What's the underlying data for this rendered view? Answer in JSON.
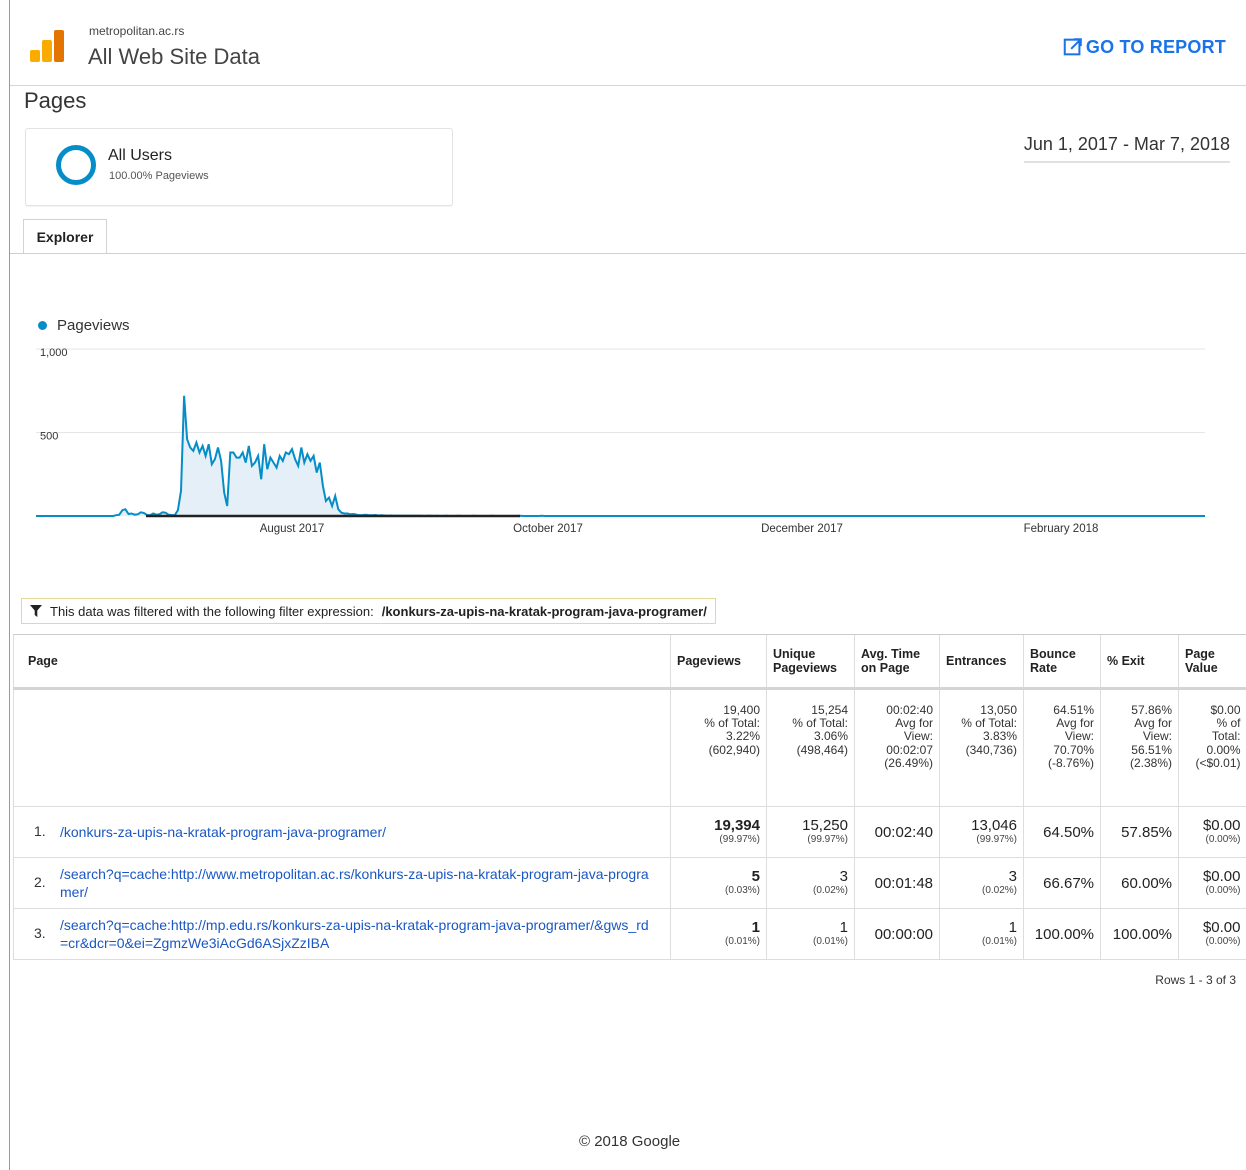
{
  "header": {
    "account": "metropolitan.ac.rs",
    "property": "All Web Site Data",
    "go_to_report": "GO TO REPORT"
  },
  "page_title": "Pages",
  "segment": {
    "name": "All Users",
    "subtitle": "100.00% Pageviews"
  },
  "date_range": "Jun 1, 2017 - Mar 7, 2018",
  "tabs": [
    {
      "label": "Explorer",
      "active": true
    }
  ],
  "chart_data": {
    "type": "area",
    "series": [
      {
        "name": "Pageviews",
        "color": "#058dc7"
      }
    ],
    "y_ticks": [
      "1,000",
      "500"
    ],
    "ylim": [
      0,
      1000
    ],
    "x_labels": [
      "August 2017",
      "October 2017",
      "December 2017",
      "February 2018"
    ],
    "values": [
      0,
      0,
      0,
      0,
      0,
      0,
      0,
      0,
      0,
      0,
      0,
      0,
      0,
      0,
      0,
      0,
      0,
      0,
      0,
      0,
      0,
      0,
      0,
      0,
      0,
      0,
      5,
      8,
      35,
      40,
      12,
      15,
      8,
      10,
      22,
      18,
      6,
      4,
      15,
      8,
      10,
      22,
      20,
      8,
      6,
      5,
      35,
      150,
      720,
      460,
      410,
      390,
      440,
      380,
      420,
      360,
      430,
      310,
      340,
      410,
      330,
      140,
      60,
      380,
      380,
      350,
      350,
      380,
      320,
      420,
      300,
      320,
      360,
      220,
      430,
      280,
      350,
      320,
      290,
      360,
      330,
      380,
      370,
      400,
      340,
      300,
      410,
      320,
      370,
      330,
      360,
      260,
      320,
      180,
      90,
      110,
      60,
      120,
      40,
      20,
      15,
      15,
      10,
      12,
      8,
      5,
      6,
      8,
      5,
      4,
      6,
      3,
      4,
      3,
      2,
      3,
      2,
      2,
      1,
      2,
      1,
      1,
      2,
      1,
      1,
      1,
      0,
      1,
      1,
      0,
      1,
      0,
      0,
      1,
      0,
      0,
      0,
      1,
      0,
      0,
      0,
      0,
      1,
      0,
      0,
      0,
      0,
      0,
      1,
      0,
      0,
      0,
      0,
      0,
      0,
      0,
      0,
      1,
      0,
      0,
      0,
      0,
      0,
      0,
      1,
      0,
      0,
      0,
      0,
      0,
      0,
      0,
      0,
      0,
      0,
      0,
      0,
      0,
      0,
      0,
      0,
      0,
      0,
      0,
      0,
      0,
      0,
      0,
      0,
      0,
      0,
      0,
      0,
      0,
      0,
      0,
      0,
      0,
      0,
      0,
      0,
      0,
      0,
      0,
      0,
      0,
      0,
      0,
      0,
      0,
      0,
      0,
      0,
      0,
      0,
      0,
      0,
      0,
      0,
      0,
      0,
      0,
      0,
      0,
      0,
      0,
      0,
      0,
      0,
      0,
      0,
      0,
      0,
      0,
      0,
      0,
      0,
      0,
      0,
      0,
      0,
      0,
      0,
      0,
      0,
      0,
      0,
      0,
      0,
      0,
      0,
      0,
      0,
      0,
      0,
      0,
      0,
      0,
      0,
      0,
      0,
      0,
      0,
      0,
      0,
      0,
      0,
      0,
      0,
      0,
      0,
      0,
      0,
      0,
      0,
      0,
      0,
      0,
      0,
      0,
      0,
      0,
      0,
      0,
      0,
      0,
      0,
      0,
      0,
      0,
      0,
      0,
      0,
      0,
      0,
      0,
      0,
      0,
      0,
      0,
      0,
      0,
      0,
      0,
      0,
      0,
      0,
      0,
      0,
      0,
      0,
      0,
      0,
      0,
      0,
      0,
      0,
      0,
      0,
      0,
      0,
      0,
      0,
      0,
      0,
      0,
      0,
      0,
      0,
      0,
      0,
      0,
      0,
      0,
      0,
      0,
      0,
      0,
      0,
      0,
      0,
      0,
      0,
      0,
      0,
      0,
      0,
      0,
      0,
      0,
      0,
      0,
      0,
      0,
      0,
      0,
      0,
      0,
      0,
      0,
      0,
      0,
      0,
      0,
      0,
      0,
      0,
      0,
      0,
      0,
      0,
      0,
      0,
      0,
      0,
      0,
      0,
      0,
      0,
      0
    ]
  },
  "filter": {
    "label": "This data was filtered with the following filter expression:",
    "expression": "/konkurs-za-upis-na-kratak-program-java-programer/"
  },
  "table": {
    "columns": [
      "Page",
      "Pageviews",
      "Unique Pageviews",
      "Avg. Time on Page",
      "Entrances",
      "Bounce Rate",
      "% Exit",
      "Page Value"
    ],
    "totals": {
      "pageviews": [
        "19,400",
        "% of Total:",
        "3.22%",
        "(602,940)"
      ],
      "unique": [
        "15,254",
        "% of Total:",
        "3.06%",
        "(498,464)"
      ],
      "avgtime": [
        "00:02:40",
        "Avg for",
        "View:",
        "00:02:07",
        "(26.49%)"
      ],
      "entrances": [
        "13,050",
        "% of Total:",
        "3.83%",
        "(340,736)"
      ],
      "bounce": [
        "64.51%",
        "Avg for",
        "View:",
        "70.70%",
        "(-8.76%)"
      ],
      "exit": [
        "57.86%",
        "Avg for",
        "View:",
        "56.51%",
        "(2.38%)"
      ],
      "value": [
        "$0.00",
        "% of",
        "Total:",
        "0.00%",
        "(<$0.01)"
      ]
    },
    "rows": [
      {
        "num": "1.",
        "page": "/konkurs-za-upis-na-kratak-program-java-programer/",
        "pageviews": "19,394",
        "pageviews_pct": "(99.97%)",
        "unique": "15,250",
        "unique_pct": "(99.97%)",
        "avgtime": "00:02:40",
        "entrances": "13,046",
        "entrances_pct": "(99.97%)",
        "bounce": "64.50%",
        "exit": "57.85%",
        "value": "$0.00",
        "value_pct": "(0.00%)"
      },
      {
        "num": "2.",
        "page": "/search?q=cache:http://www.metropolitan.ac.rs/konkurs-za-upis-na-kratak-program-java-programer/",
        "pageviews": "5",
        "pageviews_pct": "(0.03%)",
        "unique": "3",
        "unique_pct": "(0.02%)",
        "avgtime": "00:01:48",
        "entrances": "3",
        "entrances_pct": "(0.02%)",
        "bounce": "66.67%",
        "exit": "60.00%",
        "value": "$0.00",
        "value_pct": "(0.00%)"
      },
      {
        "num": "3.",
        "page": "/search?q=cache:http://mp.edu.rs/konkurs-za-upis-na-kratak-program-java-programer/&gws_rd=cr&dcr=0&ei=ZgmzWe3iAcGd6ASjxZzIBA",
        "pageviews": "1",
        "pageviews_pct": "(0.01%)",
        "unique": "1",
        "unique_pct": "(0.01%)",
        "avgtime": "00:00:00",
        "entrances": "1",
        "entrances_pct": "(0.01%)",
        "bounce": "100.00%",
        "exit": "100.00%",
        "value": "$0.00",
        "value_pct": "(0.00%)"
      }
    ],
    "rows_info": "Rows 1 - 3 of 3"
  },
  "footer": "© 2018 Google"
}
